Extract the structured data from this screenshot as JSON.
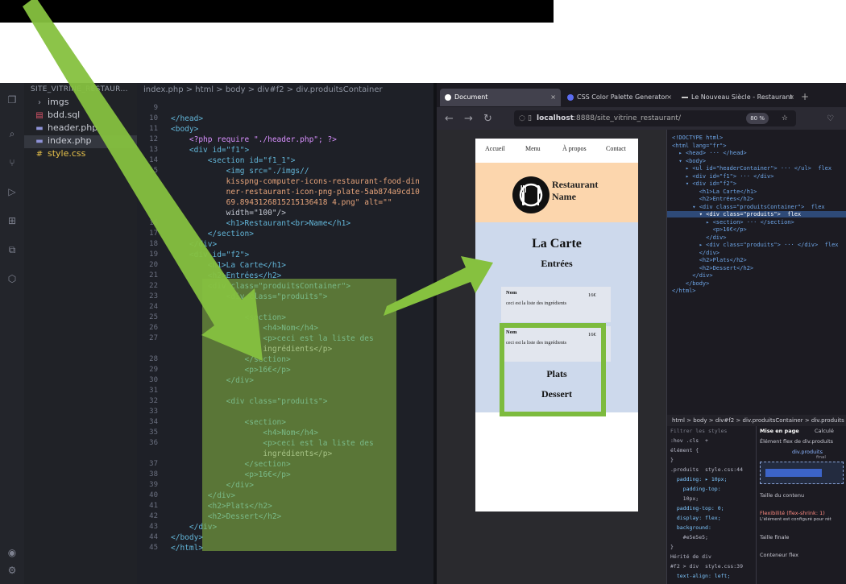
{
  "explorer": {
    "title": "SITE_VITRINE_RESTAUR...",
    "files": [
      {
        "name": "imgs",
        "icon": "chevron-right-icon"
      },
      {
        "name": "bdd.sql",
        "icon": "database-icon"
      },
      {
        "name": "header.php",
        "icon": "php-file-icon"
      },
      {
        "name": "index.php",
        "icon": "php-file-icon"
      },
      {
        "name": "style.css",
        "icon": "css-file-icon"
      }
    ]
  },
  "editor": {
    "breadcrumb": "index.php > html > body > div#f2 > div.produitsContainer",
    "lines": [
      {
        "n": "9",
        "t": ""
      },
      {
        "n": "10",
        "t": "</head>"
      },
      {
        "n": "11",
        "t": "<body>"
      },
      {
        "n": "12",
        "t": "    <?php require \"./header.php\"; ?>"
      },
      {
        "n": "13",
        "t": "    <div id=\"f1\">"
      },
      {
        "n": "14",
        "t": "        <section id=\"f1_1\">"
      },
      {
        "n": "15",
        "t": "            <img src=\"./imgs//"
      },
      {
        "n": "",
        "t": "            kisspng-computer-icons-restaurant-food-din"
      },
      {
        "n": "",
        "t": "            ner-restaurant-icon-png-plate-5ab874a9cd10"
      },
      {
        "n": "",
        "t": "            69.8943126815215136418 4.png\" alt=\"\""
      },
      {
        "n": "",
        "t": "            width=\"100\"/>"
      },
      {
        "n": "16",
        "t": "            <h1>Restaurant<br>Name</h1>"
      },
      {
        "n": "17",
        "t": "        </section>"
      },
      {
        "n": "18",
        "t": "    </div>"
      },
      {
        "n": "19",
        "t": "    <div id=\"f2\">"
      },
      {
        "n": "20",
        "t": "        <h1>La Carte</h1>"
      },
      {
        "n": "21",
        "t": "        <h2>Entrées</h2>"
      },
      {
        "n": "22",
        "t": "        <div class=\"produitsContainer\">"
      },
      {
        "n": "23",
        "t": "            <div class=\"produits\">"
      },
      {
        "n": "24",
        "t": ""
      },
      {
        "n": "25",
        "t": "                <section>"
      },
      {
        "n": "26",
        "t": "                    <h4>Nom</h4>"
      },
      {
        "n": "27",
        "t": "                    <p>ceci est la liste des"
      },
      {
        "n": "",
        "t": "                    ingrédients</p>"
      },
      {
        "n": "28",
        "t": "                </section>"
      },
      {
        "n": "29",
        "t": "                <p>16€</p>"
      },
      {
        "n": "30",
        "t": "            </div>"
      },
      {
        "n": "31",
        "t": ""
      },
      {
        "n": "32",
        "t": "            <div class=\"produits\">"
      },
      {
        "n": "33",
        "t": ""
      },
      {
        "n": "34",
        "t": "                <section>"
      },
      {
        "n": "35",
        "t": "                    <h4>Nom</h4>"
      },
      {
        "n": "36",
        "t": "                    <p>ceci est la liste des"
      },
      {
        "n": "",
        "t": "                    ingrédients</p>"
      },
      {
        "n": "37",
        "t": "                </section>"
      },
      {
        "n": "38",
        "t": "                <p>16€</p>"
      },
      {
        "n": "39",
        "t": "            </div>"
      },
      {
        "n": "40",
        "t": "        </div>"
      },
      {
        "n": "41",
        "t": "        <h2>Plats</h2>"
      },
      {
        "n": "42",
        "t": "        <h2>Dessert</h2>"
      },
      {
        "n": "43",
        "t": "    </div>"
      },
      {
        "n": "44",
        "t": "</body>"
      },
      {
        "n": "45",
        "t": "</html>"
      }
    ]
  },
  "browser": {
    "tabs": [
      {
        "label": "Document",
        "color": "#ffffff"
      },
      {
        "label": "CSS Color Palette Generator",
        "color": "#5b6cf0"
      },
      {
        "label": "Le Nouveau Siècle - Restaurant",
        "color": "#c9c9c9"
      }
    ],
    "url_host": "localhost",
    "url_rest": ":8888/site_vitrine_restaurant/",
    "zoom": "80 %"
  },
  "page": {
    "nav": [
      "Accueil",
      "Menu",
      "À propos",
      "Contact"
    ],
    "restaurant_name_1": "Restaurant",
    "restaurant_name_2": "Name",
    "title": "La Carte",
    "entrees": "Entrées",
    "products": [
      {
        "name": "Nom",
        "desc": "ceci est la liste des ingrédients",
        "price": "16€"
      },
      {
        "name": "Nom",
        "desc": "ceci est la liste des ingrédients",
        "price": "16€"
      }
    ],
    "plats": "Plats",
    "dessert": "Dessert"
  },
  "devtools": {
    "dom": [
      "<!DOCTYPE html>",
      "<html lang=\"fr\">",
      "  ▸ <head> ··· </head>",
      "  ▾ <body>",
      "    ▸ <ul id=\"headerContainer\"> ··· </ul>  flex",
      "    ▸ <div id=\"f1\"> ··· </div>",
      "    ▾ <div id=\"f2\">",
      "        <h1>La Carte</h1>",
      "        <h2>Entrées</h2>",
      "      ▾ <div class=\"produitsContainer\">  flex",
      "        ▾ <div class=\"produits\">  flex",
      "          ▸ <section> ··· </section>",
      "            <p>16€</p>",
      "          </div>",
      "        ▸ <div class=\"produits\"> ··· </div>  flex",
      "        </div>",
      "        <h2>Plats</h2>",
      "        <h2>Dessert</h2>",
      "      </div>",
      "    </body>",
      "</html>"
    ],
    "breadcrumb": "html > body > div#f2 > div.produitsContainer > div.produits",
    "filter_placeholder": "Filtrer les styles",
    "rules": [
      ":hov .cls  +",
      "élément {",
      "}",
      ".produits  style.css:44",
      "  padding: ▸ 10px;",
      "    padding-top:",
      "    10px;",
      "  padding-top: 0;",
      "  display: flex;",
      "  background:",
      "    #e5e5e5;",
      "}",
      "Hérité de div",
      "#f2 > div  style.css:39",
      "  text-align: left;"
    ],
    "layout_tab_1": "Mise en page",
    "layout_tab_2": "Calculé",
    "flex_title": "Élément flex de div.produits",
    "flex_target": "div.produits",
    "size_label": "Taille du contenu",
    "flex_label": "Flexibilité (flex-shrink: 1)",
    "flex_note": "L'élément est configuré pour rét",
    "final_size": "Taille finale",
    "flex_container": "Conteneur flex",
    "final_word": "final"
  }
}
